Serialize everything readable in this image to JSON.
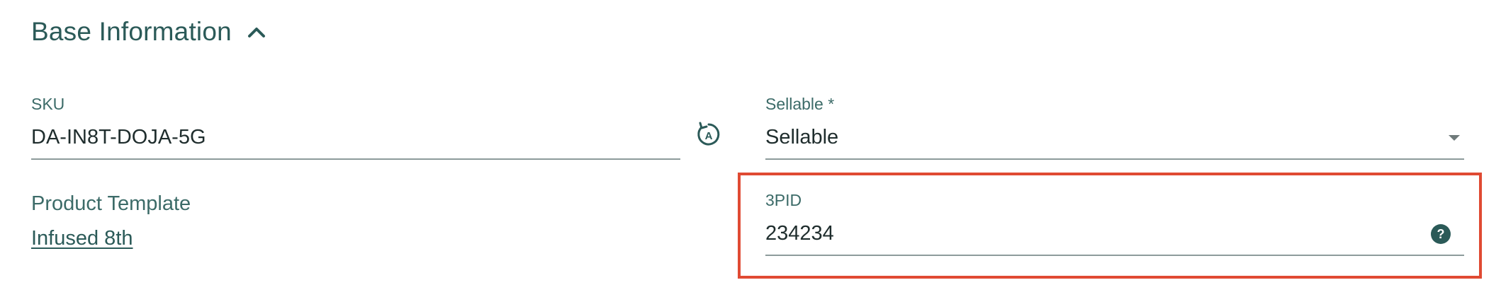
{
  "section": {
    "title": "Base Information",
    "toggle_icon": "chevron-up-icon"
  },
  "sku": {
    "label": "SKU",
    "value": "DA-IN8T-DOJA-5G",
    "regenerate_icon": "auto-regenerate-icon"
  },
  "sellable": {
    "label": "Sellable *",
    "value": "Sellable",
    "dropdown_icon": "caret-down-icon"
  },
  "product_template": {
    "label": "Product Template",
    "link": "Infused 8th"
  },
  "threepid": {
    "label": "3PID",
    "value": "234234",
    "help_icon": "help-circle-icon"
  },
  "colors": {
    "primary_text": "#2b5a58",
    "value_text": "#1f2d2d",
    "underline": "#8d9b9b",
    "highlight": "#e04a33"
  }
}
